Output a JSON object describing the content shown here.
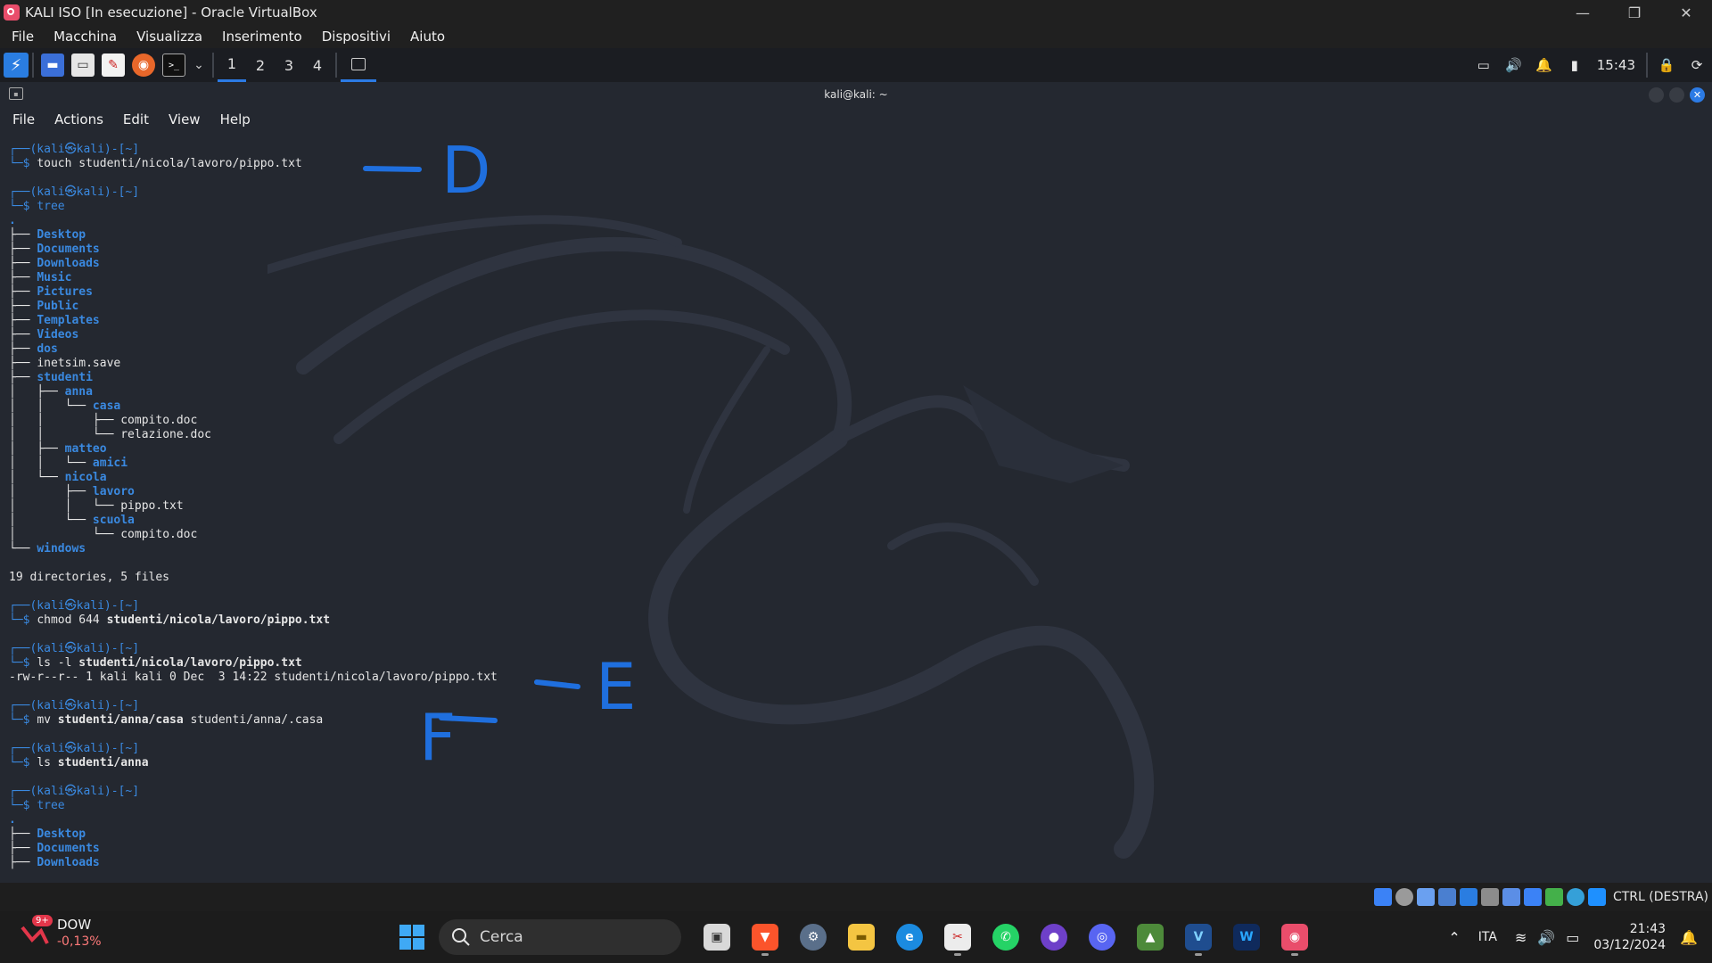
{
  "window": {
    "title": "KALI ISO [In esecuzione] - Oracle VirtualBox",
    "controls": {
      "minimize": "—",
      "restore": "❐",
      "close": "✕"
    }
  },
  "vbox_menu": [
    "File",
    "Macchina",
    "Visualizza",
    "Inserimento",
    "Dispositivi",
    "Aiuto"
  ],
  "kali_panel": {
    "workspaces": [
      "1",
      "2",
      "3",
      "4"
    ],
    "active_workspace": "1",
    "clock": "15:43"
  },
  "terminal": {
    "title": "kali@kali: ~",
    "menu": [
      "File",
      "Actions",
      "Edit",
      "View",
      "Help"
    ],
    "prompt_top": "┌──(kali㉿kali)-[~]",
    "prompt_sym": "└─$ ",
    "cmd1": "touch studenti/nicola/lavoro/pippo.txt",
    "cmd2": "tree",
    "tree_root": ".",
    "tree": [
      {
        "pre": "├── ",
        "name": "Desktop",
        "dir": true
      },
      {
        "pre": "├── ",
        "name": "Documents",
        "dir": true
      },
      {
        "pre": "├── ",
        "name": "Downloads",
        "dir": true
      },
      {
        "pre": "├── ",
        "name": "Music",
        "dir": true
      },
      {
        "pre": "├── ",
        "name": "Pictures",
        "dir": true
      },
      {
        "pre": "├── ",
        "name": "Public",
        "dir": true
      },
      {
        "pre": "├── ",
        "name": "Templates",
        "dir": true
      },
      {
        "pre": "├── ",
        "name": "Videos",
        "dir": true
      },
      {
        "pre": "├── ",
        "name": "dos",
        "dir": true
      },
      {
        "pre": "├── ",
        "name": "inetsim.save",
        "dir": false
      },
      {
        "pre": "├── ",
        "name": "studenti",
        "dir": true
      },
      {
        "pre": "│   ├── ",
        "name": "anna",
        "dir": true
      },
      {
        "pre": "│   │   └── ",
        "name": "casa",
        "dir": true
      },
      {
        "pre": "│   │       ├── ",
        "name": "compito.doc",
        "dir": false
      },
      {
        "pre": "│   │       └── ",
        "name": "relazione.doc",
        "dir": false
      },
      {
        "pre": "│   ├── ",
        "name": "matteo",
        "dir": true
      },
      {
        "pre": "│   │   └── ",
        "name": "amici",
        "dir": true
      },
      {
        "pre": "│   └── ",
        "name": "nicola",
        "dir": true
      },
      {
        "pre": "│       ├── ",
        "name": "lavoro",
        "dir": true
      },
      {
        "pre": "│       │   └── ",
        "name": "pippo.txt",
        "dir": false
      },
      {
        "pre": "│       └── ",
        "name": "scuola",
        "dir": true
      },
      {
        "pre": "│           └── ",
        "name": "compito.doc",
        "dir": false
      },
      {
        "pre": "└── ",
        "name": "windows",
        "dir": true
      }
    ],
    "tree_summary": "19 directories, 5 files",
    "cmd3_name": "chmod",
    "cmd3_mode": " 644 ",
    "cmd3_path": "studenti/nicola/lavoro/pippo.txt",
    "cmd4_name": "ls -l",
    "cmd4_path": "studenti/nicola/lavoro/pippo.txt",
    "ls_output": "-rw-r--r-- 1 kali kali 0 Dec  3 14:22 studenti/nicola/lavoro/pippo.txt",
    "cmd5_name": "mv",
    "cmd5_src": "studenti/anna/casa",
    "cmd5_dst": " studenti/anna/.casa",
    "cmd6_name": "ls",
    "cmd6_path": "studenti/anna",
    "cmd7": "tree",
    "tree2": [
      {
        "pre": "├── ",
        "name": "Desktop"
      },
      {
        "pre": "├── ",
        "name": "Documents"
      },
      {
        "pre": "├── ",
        "name": "Downloads"
      }
    ]
  },
  "annotations": {
    "d": "D",
    "e": "E",
    "f": "F",
    "ink_color": "#1f6fde"
  },
  "vbox_status": {
    "host_key": "CTRL (DESTRA)"
  },
  "taskbar": {
    "weather_badge": "9+",
    "stock_name": "DOW",
    "stock_change": "-0,13%",
    "search_placeholder": "Cerca",
    "language": "ITA",
    "time": "21:43",
    "date": "03/12/2024"
  },
  "colors": {
    "accent": "#2c7be5",
    "prompt": "#3a89e0",
    "terminal_bg": "#242830"
  }
}
